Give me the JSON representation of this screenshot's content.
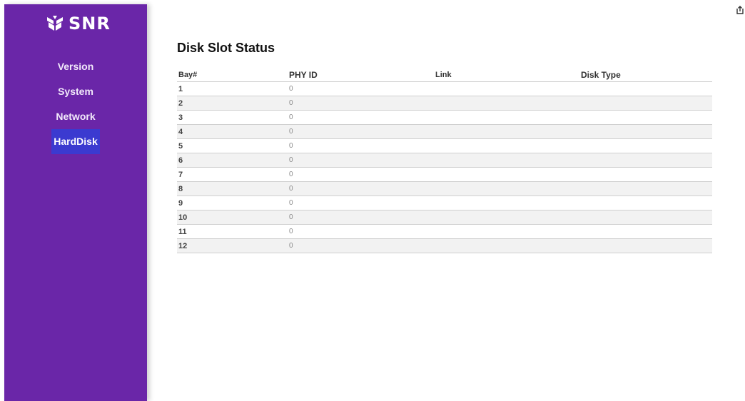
{
  "brand": {
    "name": "SNR",
    "logo_icon": "snr-logo-icon"
  },
  "sidebar": {
    "items": [
      {
        "label": "Version",
        "active": false
      },
      {
        "label": "System",
        "active": false
      },
      {
        "label": "Network",
        "active": false
      },
      {
        "label": "HardDisk",
        "active": true
      }
    ]
  },
  "corner_icon": "export-icon",
  "colors": {
    "sidebar": "#6a26a8",
    "active_item": "#3b3ad0"
  },
  "main": {
    "title": "Disk Slot Status",
    "table": {
      "columns": [
        "Bay#",
        "PHY ID",
        "Link",
        "Disk Type"
      ],
      "rows": [
        {
          "bay": "1",
          "phy_id": "0",
          "link": "",
          "disk_type": ""
        },
        {
          "bay": "2",
          "phy_id": "0",
          "link": "",
          "disk_type": ""
        },
        {
          "bay": "3",
          "phy_id": "0",
          "link": "",
          "disk_type": ""
        },
        {
          "bay": "4",
          "phy_id": "0",
          "link": "",
          "disk_type": ""
        },
        {
          "bay": "5",
          "phy_id": "0",
          "link": "",
          "disk_type": ""
        },
        {
          "bay": "6",
          "phy_id": "0",
          "link": "",
          "disk_type": ""
        },
        {
          "bay": "7",
          "phy_id": "0",
          "link": "",
          "disk_type": ""
        },
        {
          "bay": "8",
          "phy_id": "0",
          "link": "",
          "disk_type": ""
        },
        {
          "bay": "9",
          "phy_id": "0",
          "link": "",
          "disk_type": ""
        },
        {
          "bay": "10",
          "phy_id": "0",
          "link": "",
          "disk_type": ""
        },
        {
          "bay": "11",
          "phy_id": "0",
          "link": "",
          "disk_type": ""
        },
        {
          "bay": "12",
          "phy_id": "0",
          "link": "",
          "disk_type": ""
        }
      ]
    }
  }
}
